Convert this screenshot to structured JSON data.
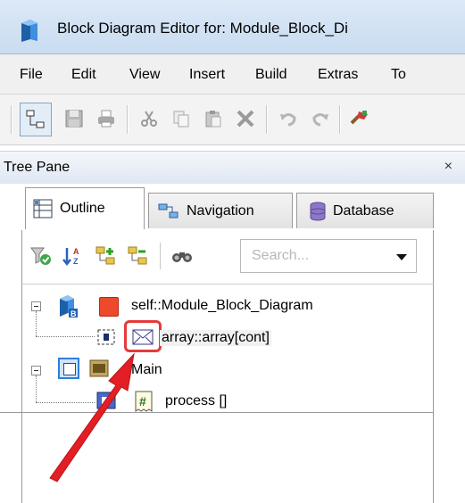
{
  "window": {
    "title": "Block Diagram Editor for: Module_Block_Di"
  },
  "menu": {
    "items": [
      "File",
      "Edit",
      "View",
      "Insert",
      "Build",
      "Extras",
      "To"
    ]
  },
  "pane": {
    "title": "Tree Pane",
    "close": "×"
  },
  "tabs": [
    {
      "label": "Outline",
      "active": true
    },
    {
      "label": "Navigation",
      "active": false
    },
    {
      "label": "Database",
      "active": false
    }
  ],
  "search": {
    "placeholder": "Search..."
  },
  "tree": {
    "root": "self::Module_Block_Diagram",
    "child1": "array::array[cont]",
    "main": "Main",
    "process": "process []"
  },
  "colors": {
    "annotation": "#e63a3a",
    "title_bar": "#d4e3f5"
  }
}
